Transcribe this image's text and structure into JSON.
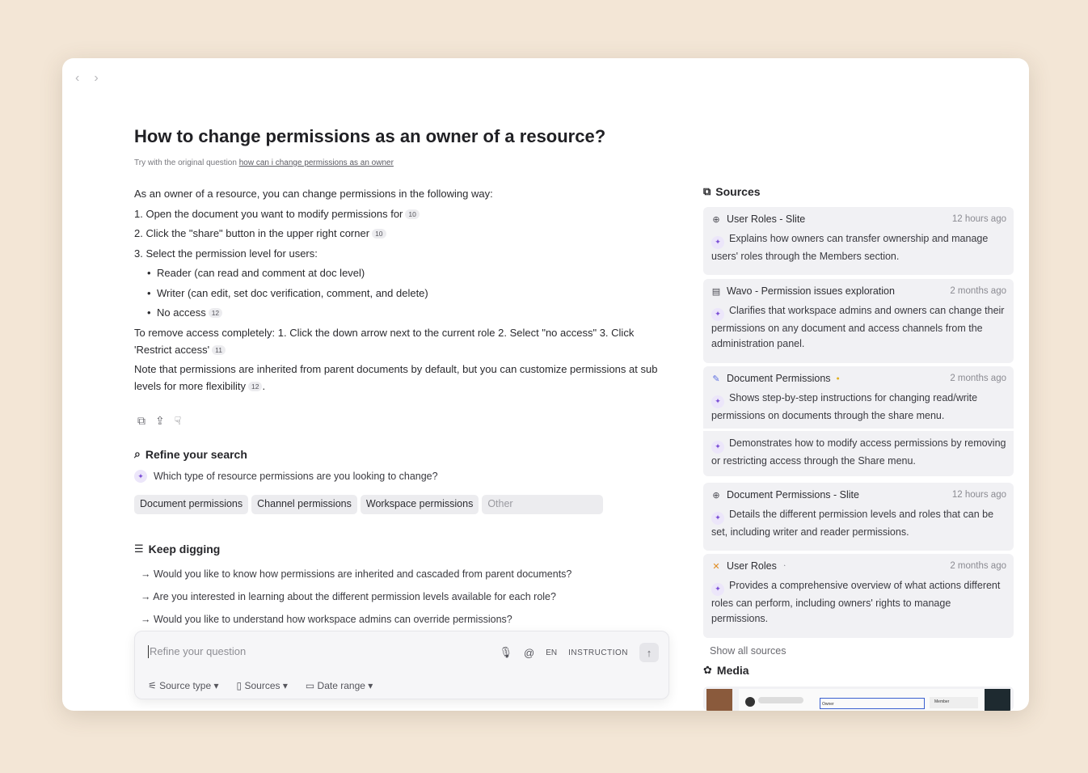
{
  "nav": {
    "back": "‹",
    "forward": "›"
  },
  "title": "How to change permissions as an owner of a resource?",
  "original": {
    "prefix": "Try with the original question",
    "link": "how can i change permissions as an owner"
  },
  "answer": {
    "intro": "As an owner of a resource, you can change permissions in the following way:",
    "step1": "1. Open the document you want to modify permissions for",
    "step1_ref": "10",
    "step2": "2. Click the \"share\" button in the upper right corner",
    "step2_ref": "10",
    "step3": "3. Select the permission level for users:",
    "bullet1": "Reader (can read and comment at doc level)",
    "bullet2": "Writer (can edit, set doc verification, comment, and delete)",
    "bullet3": "No access",
    "bullet3_ref": "12",
    "remove": "To remove access completely: 1. Click the down arrow next to the current role 2. Select \"no access\" 3. Click 'Restrict access'",
    "remove_ref": "11",
    "note": "Note that permissions are inherited from parent documents by default, but you can customize permissions at sub levels for more flexibility",
    "note_ref": "12",
    "note_end": "."
  },
  "refine": {
    "title": "Refine your search",
    "question": "Which type of resource permissions are you looking to change?",
    "chips": [
      "Document permissions",
      "Channel permissions",
      "Workspace permissions",
      "Other"
    ]
  },
  "dig": {
    "title": "Keep digging",
    "items": [
      "→ Would you like to know how permissions are inherited and cascaded from parent documents?",
      "→ Are you interested in learning about the different permission levels available for each role?",
      "→ Would you like to understand how workspace admins can override permissions?"
    ]
  },
  "composer": {
    "placeholder": "Refine your question",
    "lang": "EN",
    "mode": "INSTRUCTION",
    "filters": [
      "Source type",
      "Sources",
      "Date range"
    ]
  },
  "sources": {
    "title": "Sources",
    "items": [
      {
        "name": "User Roles - Slite",
        "time": "12 hours ago",
        "icon": "globe-icon",
        "summary": "Explains how owners can transfer ownership and manage users' roles through the Members section."
      },
      {
        "name": "Wavo - Permission issues exploration",
        "time": "2 months ago",
        "icon": "doc-icon",
        "summary": "Clarifies that workspace admins and owners can change their permissions on any document and access channels from the administration panel."
      },
      {
        "name": "Document Permissions",
        "time": "2 months ago",
        "icon": "notion-style-icon",
        "summary": "Shows step-by-step instructions for changing read/write permissions on documents through the share menu.",
        "summary2": "Demonstrates how to modify access permissions by removing or restricting access through the Share menu."
      },
      {
        "name": "Document Permissions - Slite",
        "time": "12 hours ago",
        "icon": "globe-icon",
        "summary": "Details the different permission levels and roles that can be set, including writer and reader permissions."
      },
      {
        "name": "User Roles",
        "time": "2 months ago",
        "icon": "butterfly-icon",
        "summary": "Provides a comprehensive overview of what actions different roles can perform, including owners' rights to manage permissions."
      }
    ],
    "show_all": "Show all sources"
  },
  "media": {
    "title": "Media",
    "owner_label": "Owner",
    "member_label": "Member"
  },
  "colors": {
    "accent": "#7b4fd6",
    "background": "#f3e6d6",
    "card": "#f1f1f4"
  }
}
